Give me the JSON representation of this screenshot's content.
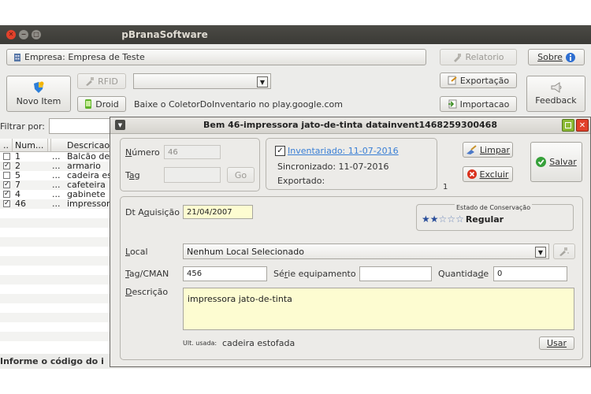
{
  "app": {
    "title": "pBranaSoftware",
    "empresa_label": "Empresa: Empresa de Teste",
    "relatorio": "Relatorio",
    "sobre": "Sobre",
    "novo_item": "Novo Item",
    "rfid": "RFID",
    "droid": "Droid",
    "droid_hint": "Baixe o ColetorDoInventario no play.google.com",
    "exportacao": "Exportação",
    "importacao": "Importacao",
    "feedback": "Feedback",
    "filtrar_label": "Filtrar por:",
    "status_bar": "Informe o código do i"
  },
  "table": {
    "columns": [
      "Num...",
      "Descricao"
    ],
    "rows": [
      {
        "checked": false,
        "num": "1",
        "dots": "...",
        "desc": "Balcão de"
      },
      {
        "checked": true,
        "num": "2",
        "dots": "...",
        "desc": "armario"
      },
      {
        "checked": false,
        "num": "5",
        "dots": "...",
        "desc": "cadeira es"
      },
      {
        "checked": true,
        "num": "7",
        "dots": "...",
        "desc": "cafeteira"
      },
      {
        "checked": true,
        "num": "4",
        "dots": "...",
        "desc": "gabinete"
      },
      {
        "checked": true,
        "num": "46",
        "dots": "...",
        "desc": "impressor"
      }
    ]
  },
  "dialog": {
    "title": "Bem 46-impressora jato-de-tinta datainvent1468259300468",
    "numero_label": "Número",
    "numero_value": "46",
    "tag_label": "Tag",
    "tag_value": "",
    "go": "Go",
    "inventariado": "Inventariado: 11-07-2016",
    "sincronizado": "Sincronizado: 11-07-2016",
    "exportado": "Exportado:",
    "count": "1",
    "limpar": "Limpar",
    "excluir": "Excluir",
    "salvar": "Salvar",
    "dt_aquisicao_label": "Dt Aquisição",
    "dt_aquisicao_value": "21/04/2007",
    "estado_title": "Estado de Conservação",
    "estado_value": "Regular",
    "estado_stars": 2,
    "estado_max": 5,
    "local_label": "Local",
    "local_value": "Nenhum Local Selecionado",
    "tagcman_label": "Tag/CMAN",
    "tagcman_value": "456",
    "serie_label": "Série equipamento",
    "serie_value": "",
    "quantidade_label": "Quantidade",
    "quantidade_value": "0",
    "descricao_label": "Descrição",
    "descricao_value": "impressora jato-de-tinta",
    "ult_usada_label": "Ult. usada:",
    "ult_usada_value": "cadeira estofada",
    "usar": "Usar"
  },
  "colors": {
    "titlebar": "#3b3a36",
    "link_blue": "#3a7fd5",
    "field_yellow": "#fdfcd1",
    "close_red": "#e2412b",
    "maximize_green": "#8dba35"
  },
  "icons": [
    "close-icon",
    "minimize-icon",
    "maximize-icon",
    "building-icon",
    "report-icon",
    "info-icon",
    "shield-icon",
    "rfid-icon",
    "android-icon",
    "export-icon",
    "import-icon",
    "megaphone-icon",
    "broom-icon",
    "delete-icon",
    "check-icon",
    "star-icon",
    "chevron-down-icon"
  ]
}
